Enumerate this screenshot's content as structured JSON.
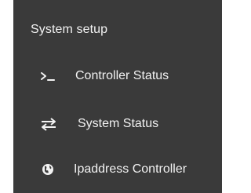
{
  "menu": {
    "section_title": "System setup",
    "items": [
      {
        "label": "Controller Status",
        "icon": "terminal-icon"
      },
      {
        "label": "System Status",
        "icon": "swap-arrows-icon"
      },
      {
        "label": "Ipaddress Controller",
        "icon": "globe-icon"
      }
    ]
  },
  "colors": {
    "panel_background": "#3a3a3a",
    "text": "#f2f2f2",
    "page_background": "#ffffff"
  }
}
